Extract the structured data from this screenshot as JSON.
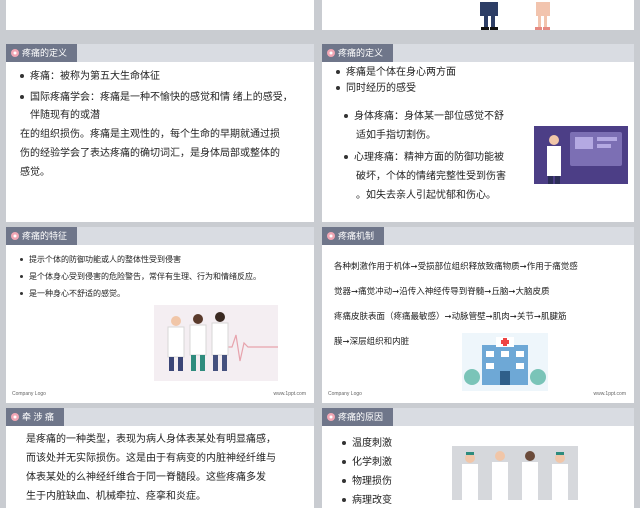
{
  "s1": {
    "title": "疼痛的定义",
    "lines": [
      "疼痛：被称为第五大生命体征",
      "国际疼痛学会：疼痛是一种不愉快的感觉和情 绪上的感受，",
      "伴随现有的或潜",
      "在的组织损伤。疼痛是主观性的，每个生命的早期就通过损",
      "伤的经验学会了表达疼痛的确切词汇，是身体局部或整体的",
      "感觉。"
    ]
  },
  "s2": {
    "title": "疼痛的定义",
    "top": [
      "疼痛是个体在身心两方面",
      "同时经历的感受"
    ],
    "physical": [
      "身体疼痛：身体某一部位感觉不舒",
      "适如手指切割伤。"
    ],
    "mental": [
      "心理疼痛：精神方面的防御功能被",
      "破坏，个体的情绪完整性受到伤害",
      "。如失去亲人引起忧郁和伤心。"
    ]
  },
  "s3": {
    "title": "疼痛的特征",
    "items": [
      "提示个体的防御功能或人的整体性受到侵害",
      "是个体身心受到侵害的危险警告，常伴有生理、行为和情绪反应。",
      "是一种身心不舒适的感觉。"
    ],
    "logo": "Company Logo",
    "url": "www.1ppt.com"
  },
  "s4": {
    "title": "疼痛机制",
    "lines": [
      "各种刺激作用于机体➞受损部位组织释放致痛物质➞作用于痛觉感",
      "觉器➞痛觉冲动➞沿传入神经传导到脊髓➞丘脑➞大脑皮质",
      "疼痛皮肤表面（疼痛最敏感）➞动脉管壁➞肌肉➞关节➞肌腱筋",
      "膜➞深层组织和内脏"
    ],
    "logo": "Company Logo",
    "url": "www.1ppt.com"
  },
  "s5": {
    "title": "牵 涉 痛",
    "lines": [
      "是疼痛的一种类型，表现为病人身体表某处有明显痛感，",
      "而该处并无实际损伤。这是由于有病变的内脏神经纤维与",
      "体表某处的么神经纤维合于同一脊髓段。这些疼痛多发",
      "生于内脏缺血、机械牵拉、痉挛和炎症。"
    ]
  },
  "s6": {
    "title": "疼痛的原因",
    "items": [
      "温度刺激",
      "化学刺激",
      "物理损伤",
      "病理改变"
    ]
  }
}
